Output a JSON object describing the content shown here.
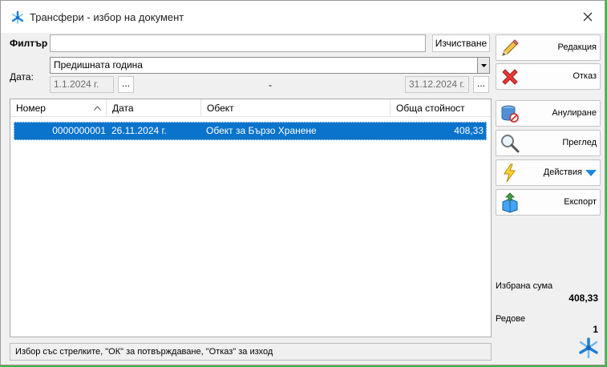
{
  "window": {
    "title": "Трансфери - избор на документ"
  },
  "filter": {
    "label": "Филтър",
    "value": "",
    "clear_label": "Изчистване"
  },
  "date": {
    "label": "Дата:",
    "period": "Предишната година",
    "from": "1.1.2024 г.",
    "to": "31.12.2024 г.",
    "separator": "-",
    "picker_label": "..."
  },
  "grid": {
    "columns": [
      "Номер",
      "Дата",
      "Обект",
      "Обща стойност"
    ],
    "rows": [
      {
        "number": "0000000001",
        "date": "26.11.2024 г.",
        "object": "Обект за Бързо Хранене",
        "total": "408,33"
      }
    ]
  },
  "status_text": "Избор със стрелките, \"ОК\" за потвърждаване, \"Отказ\" за изход",
  "actions": {
    "edit": "Редакция",
    "cancel": "Отказ",
    "annul": "Анулиране",
    "preview": "Преглед",
    "more": "Действия",
    "export": "Експорт"
  },
  "summary": {
    "sum_label": "Избрана сума",
    "sum_value": "408,33",
    "rows_label": "Редове",
    "rows_value": "1"
  },
  "colors": {
    "selection": "#0a73cc",
    "accent": "#1e88e5"
  }
}
